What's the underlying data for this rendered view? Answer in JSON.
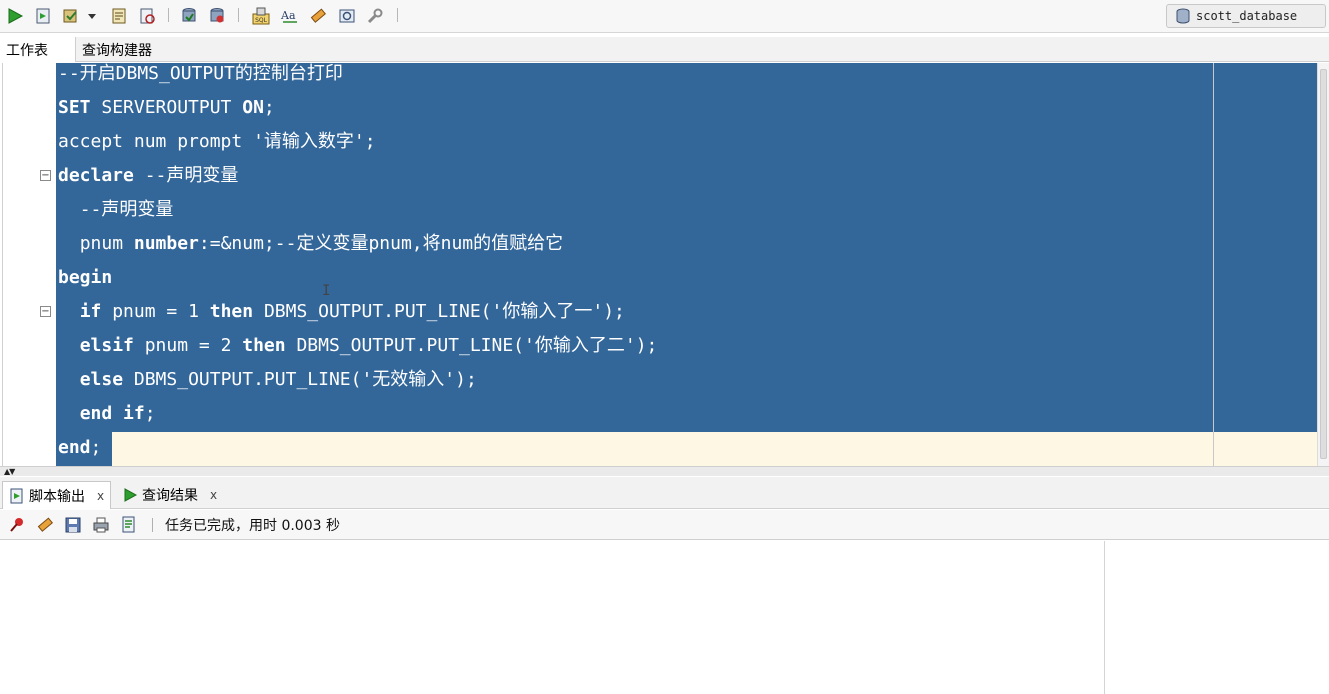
{
  "toolbar": {
    "connection": "scott_database",
    "icons": [
      "run-statement-icon",
      "run-script-icon",
      "commit-icon",
      "dropdown-icon",
      "explain-icon",
      "autotrace-icon",
      "rollback-icon",
      "history-icon",
      "sql-tuning-icon",
      "format-icon",
      "clear-icon",
      "monitor-icon",
      "tools-icon"
    ]
  },
  "tabs": {
    "worksheet": "工作表",
    "query_builder": "查询构建器"
  },
  "editor": {
    "lines": [
      {
        "indent": "",
        "parts": [
          {
            "t": "--开启DBMS_OUTPUT的控制台打印",
            "b": false
          }
        ]
      },
      {
        "indent": "",
        "parts": [
          {
            "t": "SET",
            "b": true
          },
          {
            "t": " SERVEROUTPUT ",
            "b": false
          },
          {
            "t": "ON",
            "b": true
          },
          {
            "t": ";",
            "b": false
          }
        ]
      },
      {
        "indent": "",
        "parts": [
          {
            "t": "accept num prompt '请输入数字';",
            "b": false
          }
        ]
      },
      {
        "indent": "",
        "parts": [
          {
            "t": "declare",
            "b": true
          },
          {
            "t": " --声明变量",
            "b": false
          }
        ]
      },
      {
        "indent": "  ",
        "parts": [
          {
            "t": "--声明变量",
            "b": false
          }
        ]
      },
      {
        "indent": "  ",
        "parts": [
          {
            "t": "pnum ",
            "b": false
          },
          {
            "t": "number",
            "b": true
          },
          {
            "t": ":=&num;--定义变量pnum,将num的值赋给它",
            "b": false
          }
        ]
      },
      {
        "indent": "",
        "parts": [
          {
            "t": "begin",
            "b": true
          }
        ]
      },
      {
        "indent": "  ",
        "parts": [
          {
            "t": "if",
            "b": true
          },
          {
            "t": " pnum = 1 ",
            "b": false
          },
          {
            "t": "then",
            "b": true
          },
          {
            "t": " DBMS_OUTPUT.PUT_LINE('你输入了一');",
            "b": false
          }
        ]
      },
      {
        "indent": "  ",
        "parts": [
          {
            "t": "elsif",
            "b": true
          },
          {
            "t": " pnum = 2 ",
            "b": false
          },
          {
            "t": "then",
            "b": true
          },
          {
            "t": " DBMS_OUTPUT.PUT_LINE('你输入了二');",
            "b": false
          }
        ]
      },
      {
        "indent": "  ",
        "parts": [
          {
            "t": "else",
            "b": true
          },
          {
            "t": " DBMS_OUTPUT.PUT_LINE('无效输入');",
            "b": false
          }
        ]
      },
      {
        "indent": "  ",
        "parts": [
          {
            "t": "end",
            "b": true
          },
          {
            "t": " ",
            "b": false
          },
          {
            "t": "if",
            "b": true
          },
          {
            "t": ";",
            "b": false
          }
        ]
      },
      {
        "indent": "",
        "parts": [
          {
            "t": "end",
            "b": true
          },
          {
            "t": ";",
            "b": false
          }
        ]
      }
    ],
    "selection_color": "#336699",
    "current_line_color": "#fdf7e4"
  },
  "bottom": {
    "tab_script_output": "脚本输出",
    "tab_query_result": "查询结果",
    "close": "x",
    "status": "任务已完成，用时 0.003 秒"
  }
}
